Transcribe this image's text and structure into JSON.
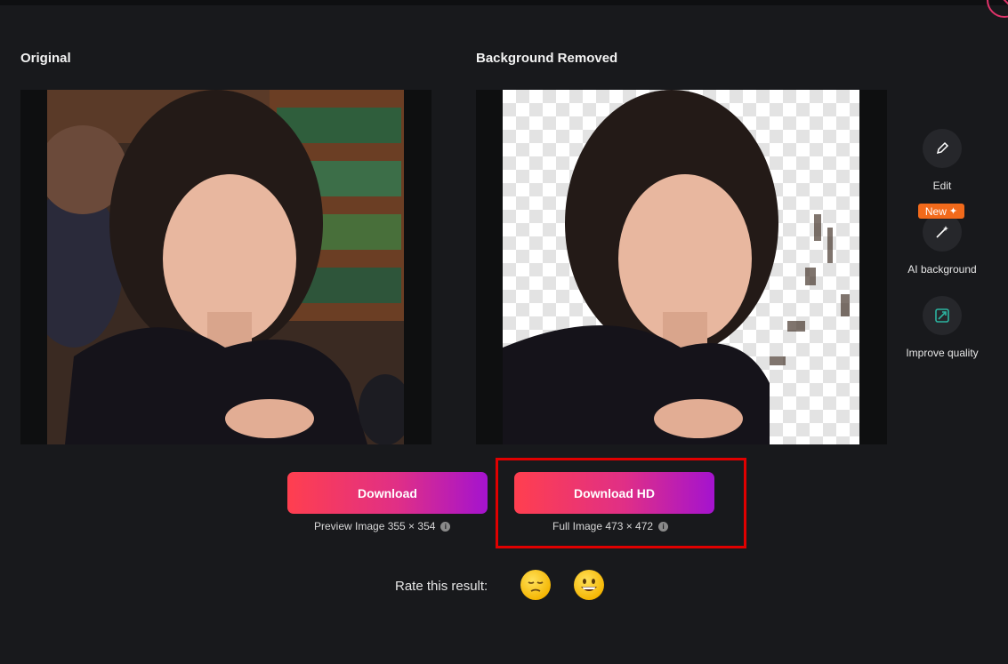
{
  "headings": {
    "original": "Original",
    "removed": "Background Removed"
  },
  "tools": [
    {
      "label": "Edit",
      "icon": "pencil-icon"
    },
    {
      "label": "AI background",
      "icon": "magic-wand-icon",
      "badge": "New"
    },
    {
      "label": "Improve quality",
      "icon": "enhance-icon"
    }
  ],
  "download": {
    "label": "Download",
    "caption": "Preview Image 355 × 354"
  },
  "download_hd": {
    "label": "Download HD",
    "caption": "Full Image 473 × 472"
  },
  "rating": {
    "prompt": "Rate this result:",
    "options": [
      "pensive-face-icon",
      "grinning-face-icon"
    ]
  },
  "colors": {
    "background": "#18191c",
    "accent_start": "#ff3f4f",
    "accent_end": "#a413cf",
    "highlight": "#e00000",
    "badge": "#f26a1b"
  }
}
